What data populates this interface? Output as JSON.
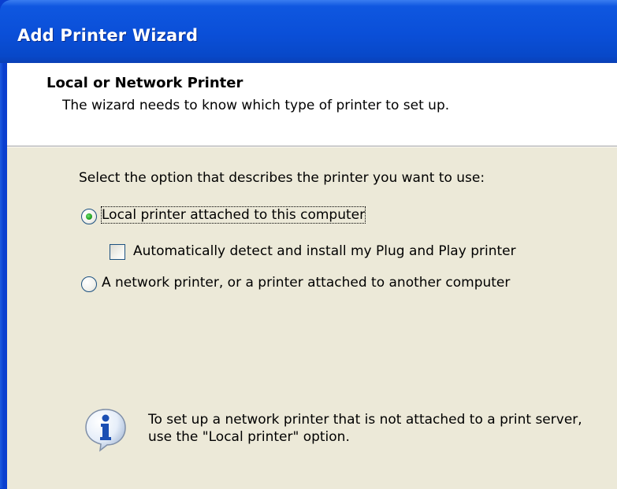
{
  "window": {
    "title": "Add Printer Wizard"
  },
  "header": {
    "title": "Local or Network Printer",
    "subtitle": "The wizard needs to know which type of printer to set up."
  },
  "body": {
    "prompt": "Select the option that describes the printer you want to use:",
    "options": [
      {
        "label": "Local printer attached to this computer",
        "selected": true
      },
      {
        "label": "A network printer, or a printer attached to another computer",
        "selected": false
      }
    ],
    "auto_detect": {
      "label": "Automatically detect and install my Plug and Play printer",
      "checked": false
    },
    "info": {
      "icon": "info-icon",
      "line1": "To set up a network printer that is not attached to a print server,",
      "line2": "use the \"Local printer\" option."
    }
  }
}
